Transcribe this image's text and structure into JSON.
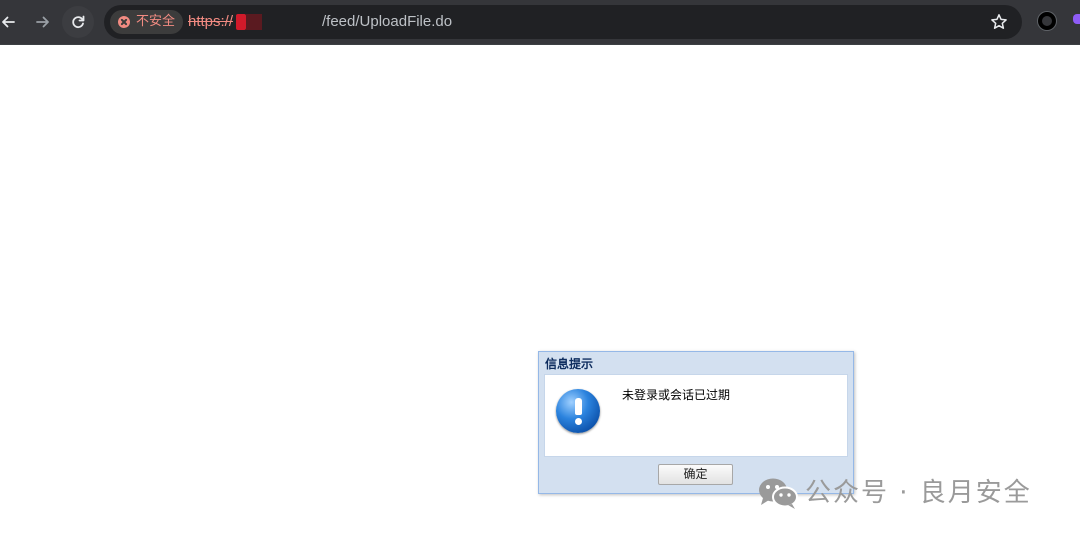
{
  "browser": {
    "nav": {
      "back_icon": "arrow-left-icon",
      "forward_icon": "arrow-right-icon",
      "reload_icon": "reload-icon"
    },
    "security_chip": {
      "icon": "not-secure-icon",
      "label": "不安全",
      "color": "#f28b82"
    },
    "url": {
      "scheme": "https://",
      "path": "/feed/UploadFile.do"
    },
    "bookmark_icon": "star-icon",
    "extension_icon": "circle-extension-icon",
    "colors": {
      "toolbar": "#35363a",
      "omnibox": "#202124"
    }
  },
  "dialog": {
    "title": "信息提示",
    "icon": "info-exclamation-icon",
    "message": "未登录或会话已过期",
    "ok_label": "确定",
    "colors": {
      "frame": "#d3e0f0",
      "border": "#95b8e7",
      "title_text": "#0e2d5f"
    }
  },
  "watermark": {
    "icon": "wechat-icon",
    "text": "公众号 · 良月安全"
  }
}
